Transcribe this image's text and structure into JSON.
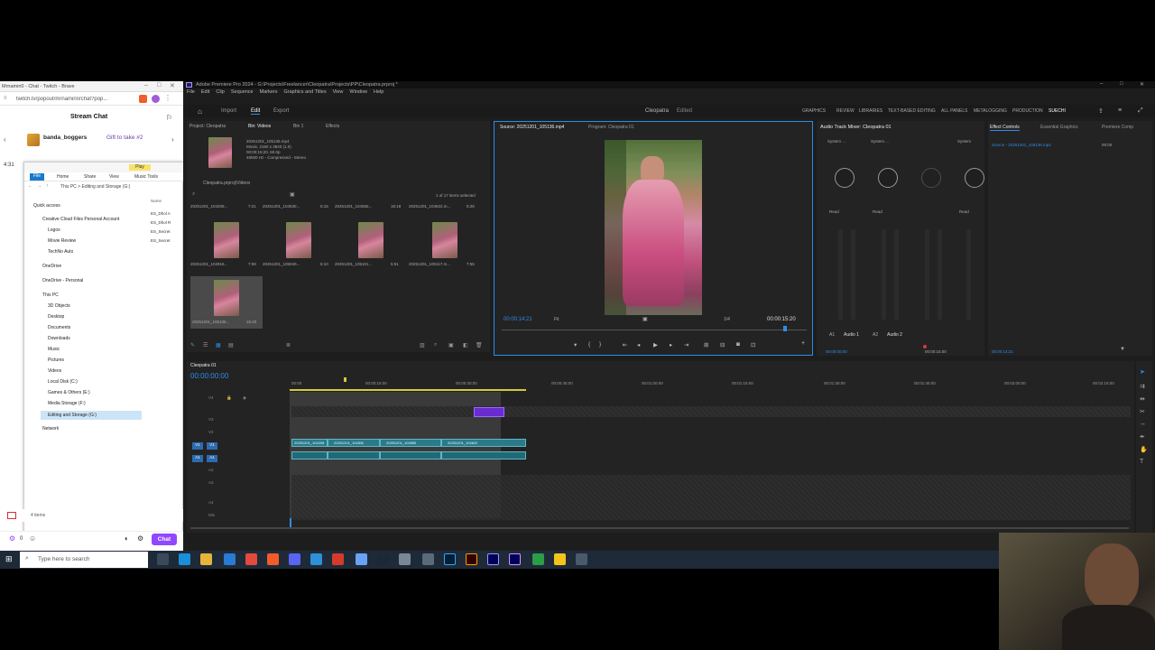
{
  "chat": {
    "window_title": "Mrnamin0 - Chat - Twitch - Brave",
    "url": "twitch.tv/popout/mrnamin0/chat?pop...",
    "title": "Stream Chat",
    "gift_user": "banda_boggers",
    "gift_text": "Gift to take #2",
    "chat_button": "Chat",
    "timestamp": "4:31",
    "points": "0"
  },
  "explorer": {
    "path": "This PC > Editing and Storage (G:)",
    "tabs": [
      "File",
      "Home",
      "Share",
      "View",
      "Music Tools"
    ],
    "play_label": "Play",
    "quick_access": "Quick access",
    "items": [
      "Creative Cloud Files Personal Account",
      "Logos",
      "Movie Review",
      "TechNo Auto",
      "OneDrive",
      "OneDrive - Personal",
      "This PC",
      "3D Objects",
      "Desktop",
      "Documents",
      "Downloads",
      "Music",
      "Pictures",
      "Videos",
      "Local Disk (C:)",
      "Games & Others (E:)",
      "Media Storage (F:)",
      "Editing and Storage (G:)",
      "Network"
    ],
    "name_header": "Name",
    "files": [
      "ES_Dhol A",
      "ES_Dhol R",
      "ES_Secret",
      "ES_Secret"
    ],
    "status": "4 items"
  },
  "premiere": {
    "title": "Adobe Premiere Pro 2024 - G:\\Projects\\Freelancer\\Cleopatra\\Projects\\PP\\Cleopatra.prproj *",
    "menu": [
      "File",
      "Edit",
      "Clip",
      "Sequence",
      "Markers",
      "Graphics and Titles",
      "View",
      "Window",
      "Help"
    ],
    "tabs": [
      "Import",
      "Edit",
      "Export"
    ],
    "project_name": "Cleopatra",
    "edited": "Edited",
    "workspaces": [
      "GRAPHICS",
      "REVIEW",
      "LIBRARIES",
      "TEXT-BASED EDITING",
      "ALL PANELS",
      "METALOGGING",
      "PRODUCTION",
      "SUECHI"
    ],
    "project_panel": {
      "tabs": [
        "Project: Cleopatra",
        "Bin: Videos",
        "Bin 1",
        "Effects"
      ],
      "clip_info": [
        "20251201_105136.mp4",
        "Movie, 2160 x 3840 (1.0)",
        "00;00;15;20, 60.0p",
        "48000 Hz - Compressed - Stereo"
      ],
      "bin_path": "Cleopatra.prproj\\Videos",
      "selected_count": "1 of 17 items selected",
      "row1": [
        {
          "name": "20251201_104208...",
          "dur": "7:21"
        },
        {
          "name": "20251201_104530...",
          "dur": "6:15"
        },
        {
          "name": "20251201_104555...",
          "dur": "16:18"
        },
        {
          "name": "20251201_104622.m...",
          "dur": "5:28"
        }
      ],
      "row2": [
        {
          "name": "20251201_104916...",
          "dur": "7:08"
        },
        {
          "name": "20251201_105040...",
          "dur": "6:10"
        },
        {
          "name": "20251201_105101...",
          "dur": "5:51"
        },
        {
          "name": "20251201_105117.m...",
          "dur": "7:55"
        }
      ],
      "row3": [
        {
          "name": "20251201_105136...",
          "dur": "15:20"
        }
      ]
    },
    "source": {
      "tab": "Source: 20251201_105136.mp4",
      "program_tab": "Program: Cleopatra 01",
      "timecode": "00:00:14:21",
      "fit": "Fit",
      "res": "1/4",
      "duration": "00:00:15:20"
    },
    "mixer": {
      "tab": "Audio Track Mixer: Cleopatra 01",
      "channels": [
        "System ...",
        "System ...",
        "",
        "System"
      ],
      "mode": "Read",
      "tracks": [
        "A1",
        "Audio 1",
        "A2",
        "Audio 2"
      ],
      "time_left": "00:00:00:00",
      "time_right": "00:00:15:00"
    },
    "effect_controls": {
      "tabs": [
        "Effect Controls",
        "Essential Graphics",
        "Premiere Comp"
      ],
      "source": "Source - 20251201_105136.mp4",
      "time": "00:00",
      "bottom_time": "00:00:14:21"
    },
    "timeline": {
      "tab": "Cleopatra 01",
      "timecode": "00:00:00:00",
      "ruler": [
        "00:00",
        "00:00:15:00",
        "00:00:30:00",
        "00:00:45:00",
        "00:01:00:00",
        "00:01:15:00",
        "00:01:30:00",
        "00:01:45:00",
        "00:02:00:00",
        "00:02:15:00"
      ],
      "video_tracks": [
        "V4",
        "V3",
        "V2",
        "V1"
      ],
      "audio_tracks": [
        "A1",
        "A2",
        "A3",
        "A4"
      ],
      "mix": "Mix",
      "clips": [
        "20251201_104208",
        "20251201_104530",
        "20251201_104555",
        "20251201_104622"
      ]
    }
  },
  "taskbar": {
    "search": "Type here to search"
  }
}
